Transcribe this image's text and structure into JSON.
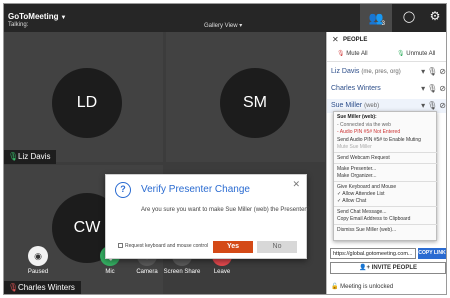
{
  "app": {
    "brand": "GoToMeeting",
    "talking_label": "Talking:",
    "view_label": "Gallery View",
    "people_count": "3"
  },
  "tiles": [
    {
      "initials": "LD",
      "name": "Liz Davis",
      "mic_icon": "mic-on-icon"
    },
    {
      "initials": "SM"
    },
    {
      "initials": "CW",
      "name": "Charles Winters",
      "mic_icon": "mic-muted-icon"
    }
  ],
  "controls": {
    "paused": "Paused",
    "mic": "Mic",
    "camera": "Camera",
    "screen_share": "Screen Share",
    "leave": "Leave"
  },
  "dialog": {
    "title": "Verify Presenter Change",
    "message": "Are you sure you want to make Sue Miller (web) the Presenter?",
    "checkbox_label": "Request keyboard and mouse control",
    "yes": "Yes",
    "no": "No"
  },
  "people": {
    "title": "PEOPLE",
    "mute_all": "Mute All",
    "unmute_all": "Unmute All",
    "attendees": [
      {
        "name": "Liz Davis",
        "role": "(me, pres, org)"
      },
      {
        "name": "Charles Winters",
        "role": ""
      },
      {
        "name": "Sue Miller",
        "role": "(web)"
      }
    ],
    "context_menu": [
      {
        "label": "Sue Miller (web):",
        "style": "head"
      },
      {
        "label": "- Connected via the web",
        "style": "note"
      },
      {
        "label": "- Audio PIN #5# Not Entered",
        "style": "warn"
      },
      {
        "label": "Send Audio PIN #5# to Enable Muting",
        "style": "normal"
      },
      {
        "label": "Mute Sue Miller",
        "style": "dis"
      },
      {
        "label": "Send Webcam Request",
        "style": "normal"
      },
      {
        "label": "Make Presenter...",
        "style": "normal"
      },
      {
        "label": "Make Organizer...",
        "style": "normal"
      },
      {
        "label": "Give Keyboard and Mouse",
        "style": "normal"
      },
      {
        "label": "✓ Allow Attendee List",
        "style": "normal"
      },
      {
        "label": "✓ Allow Chat",
        "style": "normal"
      },
      {
        "label": "Send Chat Message...",
        "style": "normal"
      },
      {
        "label": "Copy Email Address to Clipboard",
        "style": "normal"
      },
      {
        "label": "Dismiss Sue Miller (web)...",
        "style": "normal"
      }
    ],
    "meeting_link": "https://global.gotomeeting.com...",
    "copy_link": "COPY LINK",
    "invite": "INVITE PEOPLE",
    "lock_status": "Meeting is unlocked"
  }
}
